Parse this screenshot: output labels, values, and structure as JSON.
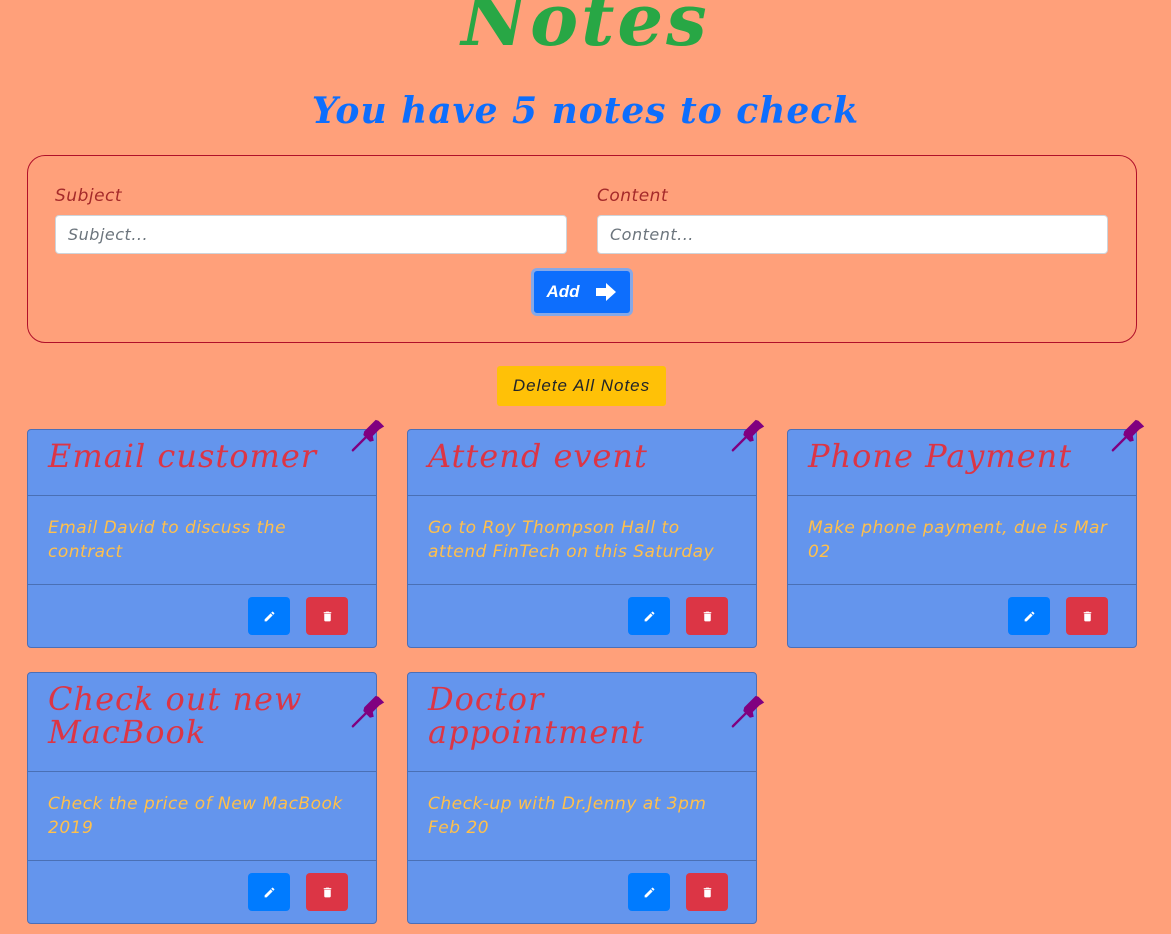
{
  "header": {
    "title": "Notes",
    "subtitle": "You have 5 notes to check"
  },
  "form": {
    "subject_label": "Subject",
    "subject_placeholder": "Subject...",
    "subject_value": "",
    "content_label": "Content",
    "content_placeholder": "Content...",
    "content_value": "",
    "add_label": "Add"
  },
  "actions": {
    "delete_all_label": "Delete All Notes"
  },
  "notes": [
    {
      "title": "Email customer",
      "content": "Email David to discuss the contract"
    },
    {
      "title": "Attend event",
      "content": "Go to Roy Thompson Hall to attend FinTech on this Saturday"
    },
    {
      "title": "Phone Payment",
      "content": "Make phone payment, due is Mar 02"
    },
    {
      "title": "Check out new MacBook",
      "content": "Check the price of New MacBook 2019"
    },
    {
      "title": "Doctor appointment",
      "content": "Check-up with Dr.Jenny at 3pm Feb 20"
    }
  ],
  "icons": {
    "add": "arrow-right-icon",
    "pin": "pushpin-icon",
    "edit": "pencil-icon",
    "delete": "trash-icon"
  },
  "colors": {
    "background": "#FFA07A",
    "title": "#28a745",
    "subtitle": "#0d6efd",
    "card": "#6495ED",
    "note_title": "#dc3545",
    "note_content": "#FFC04C",
    "pin": "#800080",
    "delete_all": "#ffc107"
  }
}
